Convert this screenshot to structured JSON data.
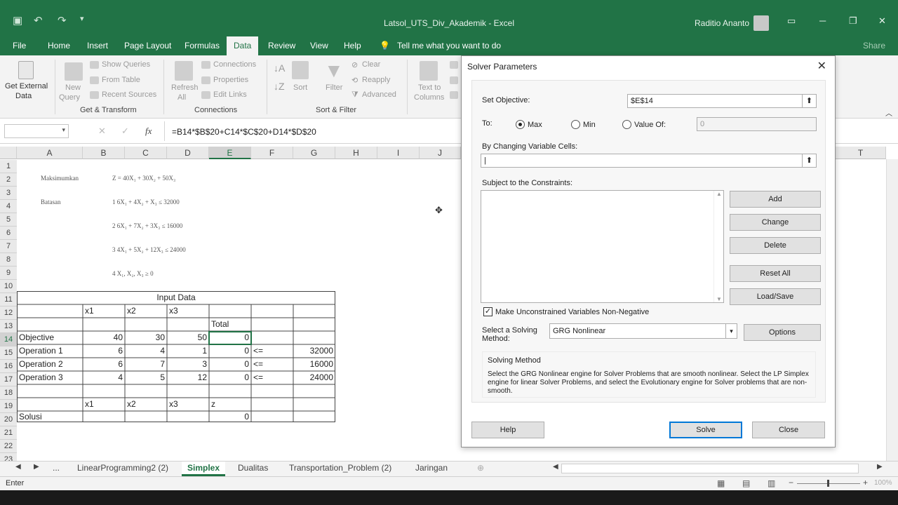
{
  "window": {
    "title": "Latsol_UTS_Div_Akademik - Excel",
    "user": "Raditio Ananto",
    "minimize": "─",
    "restore": "❐",
    "close": "✕"
  },
  "ribbon_tabs": [
    "File",
    "Home",
    "Insert",
    "Page Layout",
    "Formulas",
    "Data",
    "Review",
    "View",
    "Help"
  ],
  "tell_me": "Tell me what you want to do",
  "share": "Share",
  "ribbon": {
    "get_external_1": "Get External",
    "get_external_2": "Data",
    "new_query_1": "New",
    "new_query_2": "Query",
    "show_queries": "Show Queries",
    "from_table": "From Table",
    "recent_sources": "Recent Sources",
    "group_get_transform": "Get & Transform",
    "refresh_1": "Refresh",
    "refresh_2": "All",
    "connections": "Connections",
    "properties": "Properties",
    "edit_links": "Edit Links",
    "group_connections": "Connections",
    "sort": "Sort",
    "filter": "Filter",
    "clear": "Clear",
    "reapply": "Reapply",
    "advanced": "Advanced",
    "group_sort_filter": "Sort & Filter",
    "text_to_1": "Text to",
    "text_to_2": "Columns"
  },
  "formula_bar": {
    "fx": "fx",
    "formula": "=B14*$B$20+C14*$C$20+D14*$D$20"
  },
  "columns": [
    "A",
    "B",
    "C",
    "D",
    "E",
    "F",
    "G",
    "H",
    "I",
    "J",
    "T"
  ],
  "rows": [
    "1",
    "2",
    "3",
    "4",
    "5",
    "6",
    "7",
    "8",
    "9",
    "10",
    "11",
    "12",
    "13",
    "14",
    "15",
    "16",
    "17",
    "18",
    "19",
    "20",
    "21",
    "22",
    "23"
  ],
  "math_image": {
    "l1": "Maksimumkan",
    "l1b": "Z = 40X₁ + 30X₂ + 50X₃",
    "l2": "Batasan",
    "l2b": "1  6X₁ + 4X₂ + X₃ ≤ 32000",
    "l3": "2  6X₁ + 7X₂ + 3X₃ ≤ 16000",
    "l4": "3  4X₁ + 5X₂ + 12X₃ ≤ 24000",
    "l5": "4  X₁, X₂, X₃ ≥ 0"
  },
  "table": {
    "input_data": "Input Data",
    "x1": "x1",
    "x2": "x2",
    "x3": "x3",
    "total": "Total",
    "objective": "Objective",
    "obj_b": "40",
    "obj_c": "30",
    "obj_d": "50",
    "obj_e": "0",
    "op1": "Operation 1",
    "op1_b": "6",
    "op1_c": "4",
    "op1_d": "1",
    "op1_e": "0",
    "op1_f": "<=",
    "op1_g": "32000",
    "op2": "Operation 2",
    "op2_b": "6",
    "op2_c": "7",
    "op2_d": "3",
    "op2_e": "0",
    "op2_f": "<=",
    "op2_g": "16000",
    "op3": "Operation 3",
    "op3_b": "4",
    "op3_c": "5",
    "op3_d": "12",
    "op3_e": "0",
    "op3_f": "<=",
    "op3_g": "24000",
    "z": "z",
    "solusi": "Solusi",
    "sol_e": "0"
  },
  "sheet_tabs": [
    "LinearProgramming2 (2)",
    "Simplex",
    "Dualitas",
    "Transportation_Problem (2)",
    "Jaringan"
  ],
  "sheet_nav": "...",
  "status": {
    "mode": "Enter",
    "zoom": "100%"
  },
  "solver": {
    "title": "Solver Parameters",
    "set_objective_label": "Set Objective:",
    "set_objective_value": "$E$14",
    "to_label": "To:",
    "max": "Max",
    "min": "Min",
    "value_of": "Value Of:",
    "value_of_value": "0",
    "changing_label": "By Changing Variable Cells:",
    "changing_value": "",
    "constraints_label": "Subject to the Constraints:",
    "add": "Add",
    "change": "Change",
    "delete": "Delete",
    "reset_all": "Reset All",
    "load_save": "Load/Save",
    "nonneg_label": "Make Unconstrained Variables Non-Negative",
    "method_label_1": "Select a Solving",
    "method_label_2": "Method:",
    "method_value": "GRG Nonlinear",
    "options": "Options",
    "solving_method_title": "Solving Method",
    "solving_method_text": "Select the GRG Nonlinear engine for Solver Problems that are smooth nonlinear. Select the LP Simplex engine for linear Solver Problems, and select the Evolutionary engine for Solver problems that are non-smooth.",
    "help": "Help",
    "solve": "Solve",
    "close": "Close"
  }
}
